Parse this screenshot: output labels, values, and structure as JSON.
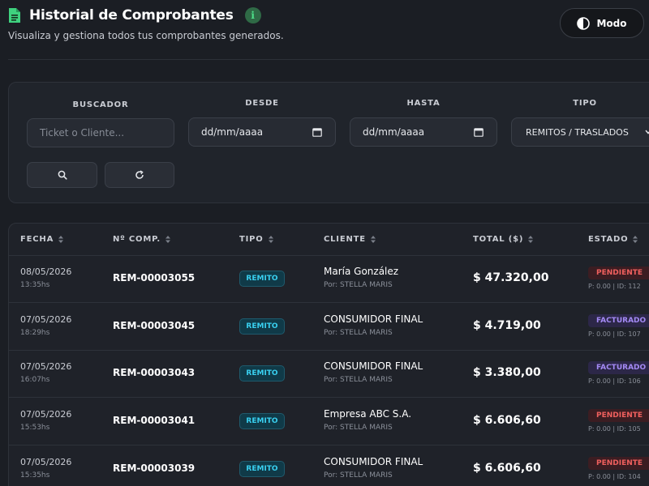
{
  "header": {
    "title": "Historial de Comprobantes",
    "subtitle": "Visualiza y gestiona todos tus comprobantes generados.",
    "mode_label": "Modo"
  },
  "filters": {
    "buscador_label": "BUSCADOR",
    "buscador_placeholder": "Ticket o Cliente...",
    "desde_label": "DESDE",
    "desde_value": "dd/mm/aaaa",
    "hasta_label": "HASTA",
    "hasta_value": "dd/mm/aaaa",
    "tipo_label": "TIPO",
    "tipo_value": "REMITOS / TRASLADOS"
  },
  "table": {
    "columns": [
      "FECHA",
      "Nº COMP.",
      "TIPO",
      "CLIENTE",
      "TOTAL ($)",
      "ESTADO"
    ],
    "rows": [
      {
        "date": "08/05/2026",
        "time": "13:35hs",
        "number": "REM-00003055",
        "type": "REMITO",
        "client": "María González",
        "by": "Por: STELLA MARIS",
        "total": "$ 47.320,00",
        "status": "PENDIENTE",
        "status_kind": "pending",
        "payment_id": "P: 0.00 | ID: 112"
      },
      {
        "date": "07/05/2026",
        "time": "18:29hs",
        "number": "REM-00003045",
        "type": "REMITO",
        "client": "CONSUMIDOR FINAL",
        "by": "Por: STELLA MARIS",
        "total": "$ 4.719,00",
        "status": "FACTURADO",
        "status_kind": "billed",
        "payment_id": "P: 0.00 | ID: 107"
      },
      {
        "date": "07/05/2026",
        "time": "16:07hs",
        "number": "REM-00003043",
        "type": "REMITO",
        "client": "CONSUMIDOR FINAL",
        "by": "Por: STELLA MARIS",
        "total": "$ 3.380,00",
        "status": "FACTURADO",
        "status_kind": "billed",
        "payment_id": "P: 0.00 | ID: 106"
      },
      {
        "date": "07/05/2026",
        "time": "15:53hs",
        "number": "REM-00003041",
        "type": "REMITO",
        "client": "Empresa ABC S.A.",
        "by": "Por: STELLA MARIS",
        "total": "$ 6.606,60",
        "status": "PENDIENTE",
        "status_kind": "pending",
        "payment_id": "P: 0.00 | ID: 105"
      },
      {
        "date": "07/05/2026",
        "time": "15:35hs",
        "number": "REM-00003039",
        "type": "REMITO",
        "client": "CONSUMIDOR FINAL",
        "by": "Por: STELLA MARIS",
        "total": "$ 6.606,60",
        "status": "PENDIENTE",
        "status_kind": "pending",
        "payment_id": "P: 0.00 | ID: 104"
      }
    ]
  },
  "colors": {
    "background": "#1b1e24",
    "accent_green": "#4ee08a",
    "type_badge": "#39d0f0",
    "pending": "#f0605e",
    "billed": "#a48af5"
  },
  "icons": [
    "document-icon",
    "info-icon",
    "contrast-icon",
    "calendar-icon",
    "chevron-down-icon",
    "search-icon",
    "refresh-icon",
    "sort-icon"
  ]
}
